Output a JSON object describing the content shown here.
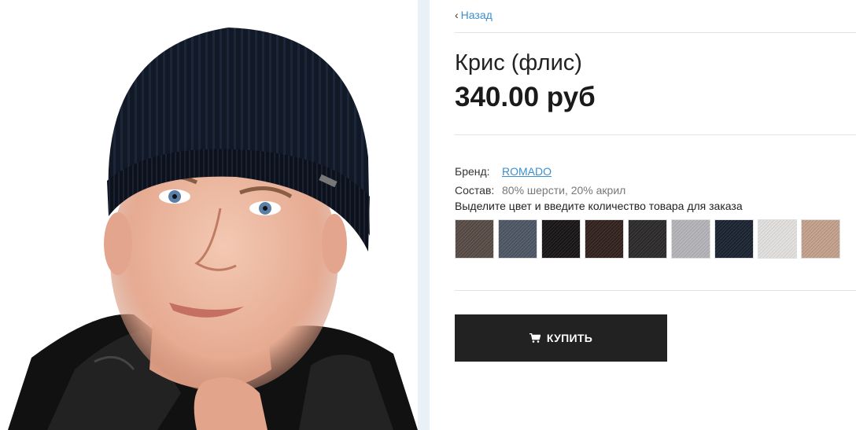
{
  "nav": {
    "back_label": "Назад"
  },
  "product": {
    "title": "Крис (флис)",
    "price": "340.00 руб",
    "properties": [
      {
        "key": "Бренд:",
        "value": "ROMADO",
        "is_link": true
      },
      {
        "key": "Состав:",
        "value": "80% шерсти, 20% акрил",
        "is_link": false
      }
    ],
    "color_hint": "Выделите цвет и введите количество товара для заказа",
    "swatches": [
      {
        "name": "swatch-brown-grey",
        "color": "#5a4d48"
      },
      {
        "name": "swatch-steel-blue",
        "color": "#4f5966"
      },
      {
        "name": "swatch-black",
        "color": "#181617"
      },
      {
        "name": "swatch-dark-brown",
        "color": "#33231e"
      },
      {
        "name": "swatch-charcoal",
        "color": "#2d2b2b"
      },
      {
        "name": "swatch-light-grey",
        "color": "#b9b9bd"
      },
      {
        "name": "swatch-navy",
        "color": "#1b2433"
      },
      {
        "name": "swatch-white",
        "color": "#e8e6e4"
      },
      {
        "name": "swatch-beige",
        "color": "#c8a48f"
      }
    ],
    "buy_label": "КУПИТЬ"
  },
  "colors": {
    "accent": "#3a8fd0",
    "button_bg": "#222222",
    "divider": "#e2e2e2"
  }
}
